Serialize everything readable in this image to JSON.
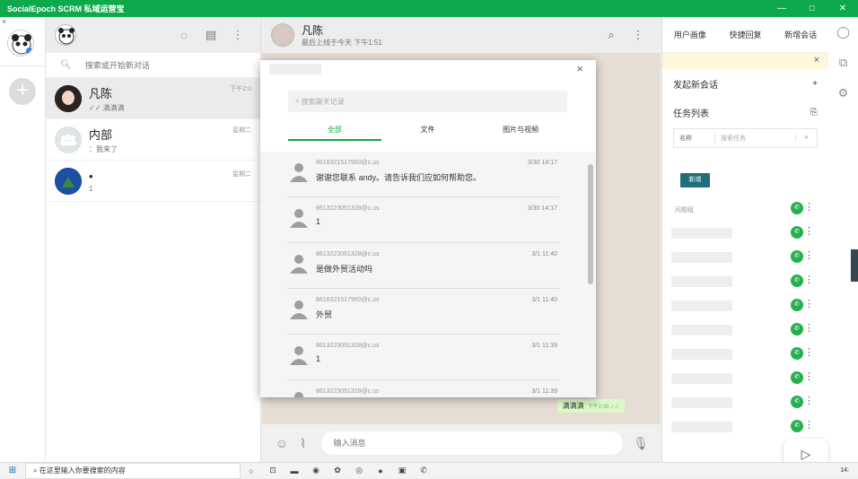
{
  "window": {
    "title": "SocialEpoch SCRM 私域运营宝",
    "min_glyph": "—",
    "max_glyph": "□",
    "close_glyph": "✕"
  },
  "rail": {
    "close_glyph": "×",
    "add_glyph": "+"
  },
  "chats": {
    "search_placeholder": "搜索或开始新对话",
    "items": [
      {
        "name": "凡陈",
        "time": "下午2:0",
        "preview": "✓✓ 满满满"
      },
      {
        "name": "内部",
        "time": "星期二",
        "preview": "：我来了"
      },
      {
        "name": "•",
        "time": "星期二",
        "preview": "1"
      }
    ]
  },
  "conversation": {
    "name": "凡陈",
    "last_seen": "最后上线于今天 下午1:51",
    "input_placeholder": "输入消息",
    "bubbles": [
      {
        "text": "满满满",
        "time": "下午2:08 ✓✓"
      }
    ]
  },
  "panel": {
    "tabs": [
      "用户画像",
      "快捷回复",
      "新增会话"
    ],
    "banner_close": "×",
    "start_chat": "发起新会话",
    "start_chat_glyph": "+",
    "task_list": "任务列表",
    "filter_select": "名称",
    "filter_placeholder": "搜索任务",
    "new_button": "新增",
    "group_label": "问题组"
  },
  "modal": {
    "close_glyph": "×",
    "search_placeholder": "搜索聊天记录",
    "tabs": [
      "全部",
      "文件",
      "图片与视频"
    ],
    "messages": [
      {
        "sender": "8618321517960@c.us",
        "time": "3/30 14:17",
        "text": "谢谢您联系 andy。请告诉我们应如何帮助您。"
      },
      {
        "sender": "8613223051328@c.us",
        "time": "3/30 14:17",
        "text": "1"
      },
      {
        "sender": "8613223051328@c.us",
        "time": "3/1 11:40",
        "text": "是做外贸活动吗"
      },
      {
        "sender": "8618321517960@c.us",
        "time": "3/1 11:40",
        "text": "外贸"
      },
      {
        "sender": "8613223051328@c.us",
        "time": "3/1 11:39",
        "text": "1"
      },
      {
        "sender": "8613223051328@c.us",
        "time": "3/1 11:39",
        "text": ""
      }
    ]
  },
  "taskbar": {
    "search_placeholder": "在这里输入你要搜索的内容",
    "clock": "14:"
  },
  "colors": {
    "brand": "#0fa94d",
    "accent_tab": "#16a34a",
    "bubble": "#dcf8c6",
    "new_button": "#1f6e7a"
  }
}
